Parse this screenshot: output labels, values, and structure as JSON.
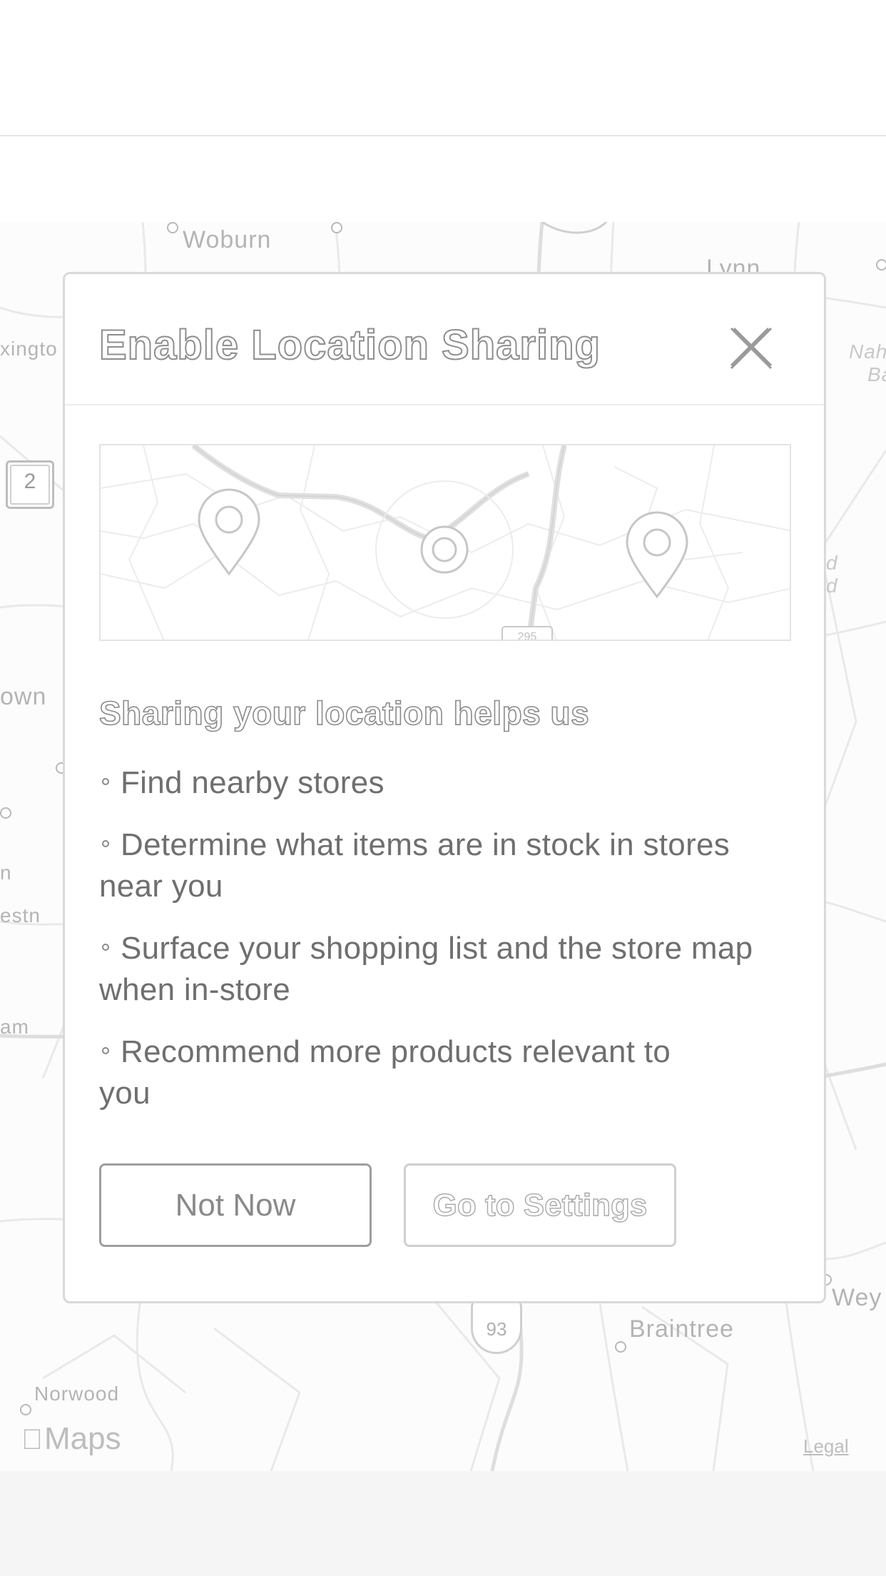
{
  "map": {
    "labels": {
      "woburn": "Woburn",
      "lynn": "Lynn",
      "lexington_partial": "xingto",
      "nahant_partial_1": "Nah",
      "nahant_partial_2": "Ba",
      "town_partial_1": "own",
      "town_partial_2": "n",
      "town_partial_3": "estn",
      "town_partial_4": "am",
      "right_partial_1": "d",
      "right_partial_2": "d",
      "weymouth_partial": "Wey",
      "braintree": "Braintree",
      "norwood": "Norwood"
    },
    "route_number": "2",
    "interstate_93": "93",
    "maps_brand": "Maps",
    "legal": "Legal"
  },
  "modal": {
    "title": "Enable Location Sharing",
    "preview_shield": "295",
    "heading": "Sharing your location helps us",
    "benefits": [
      "Find nearby stores",
      "Determine what items are in stock in stores near you",
      "Surface your shopping list and the store map when in-store",
      "Recommend more products relevant to you"
    ],
    "buttons": {
      "not_now": "Not Now",
      "go_to_settings": "Go to Settings"
    }
  },
  "icons": {
    "close": "close-icon",
    "pin": "map-pin-icon",
    "location": "current-location-icon",
    "apple": "apple-logo-icon"
  }
}
